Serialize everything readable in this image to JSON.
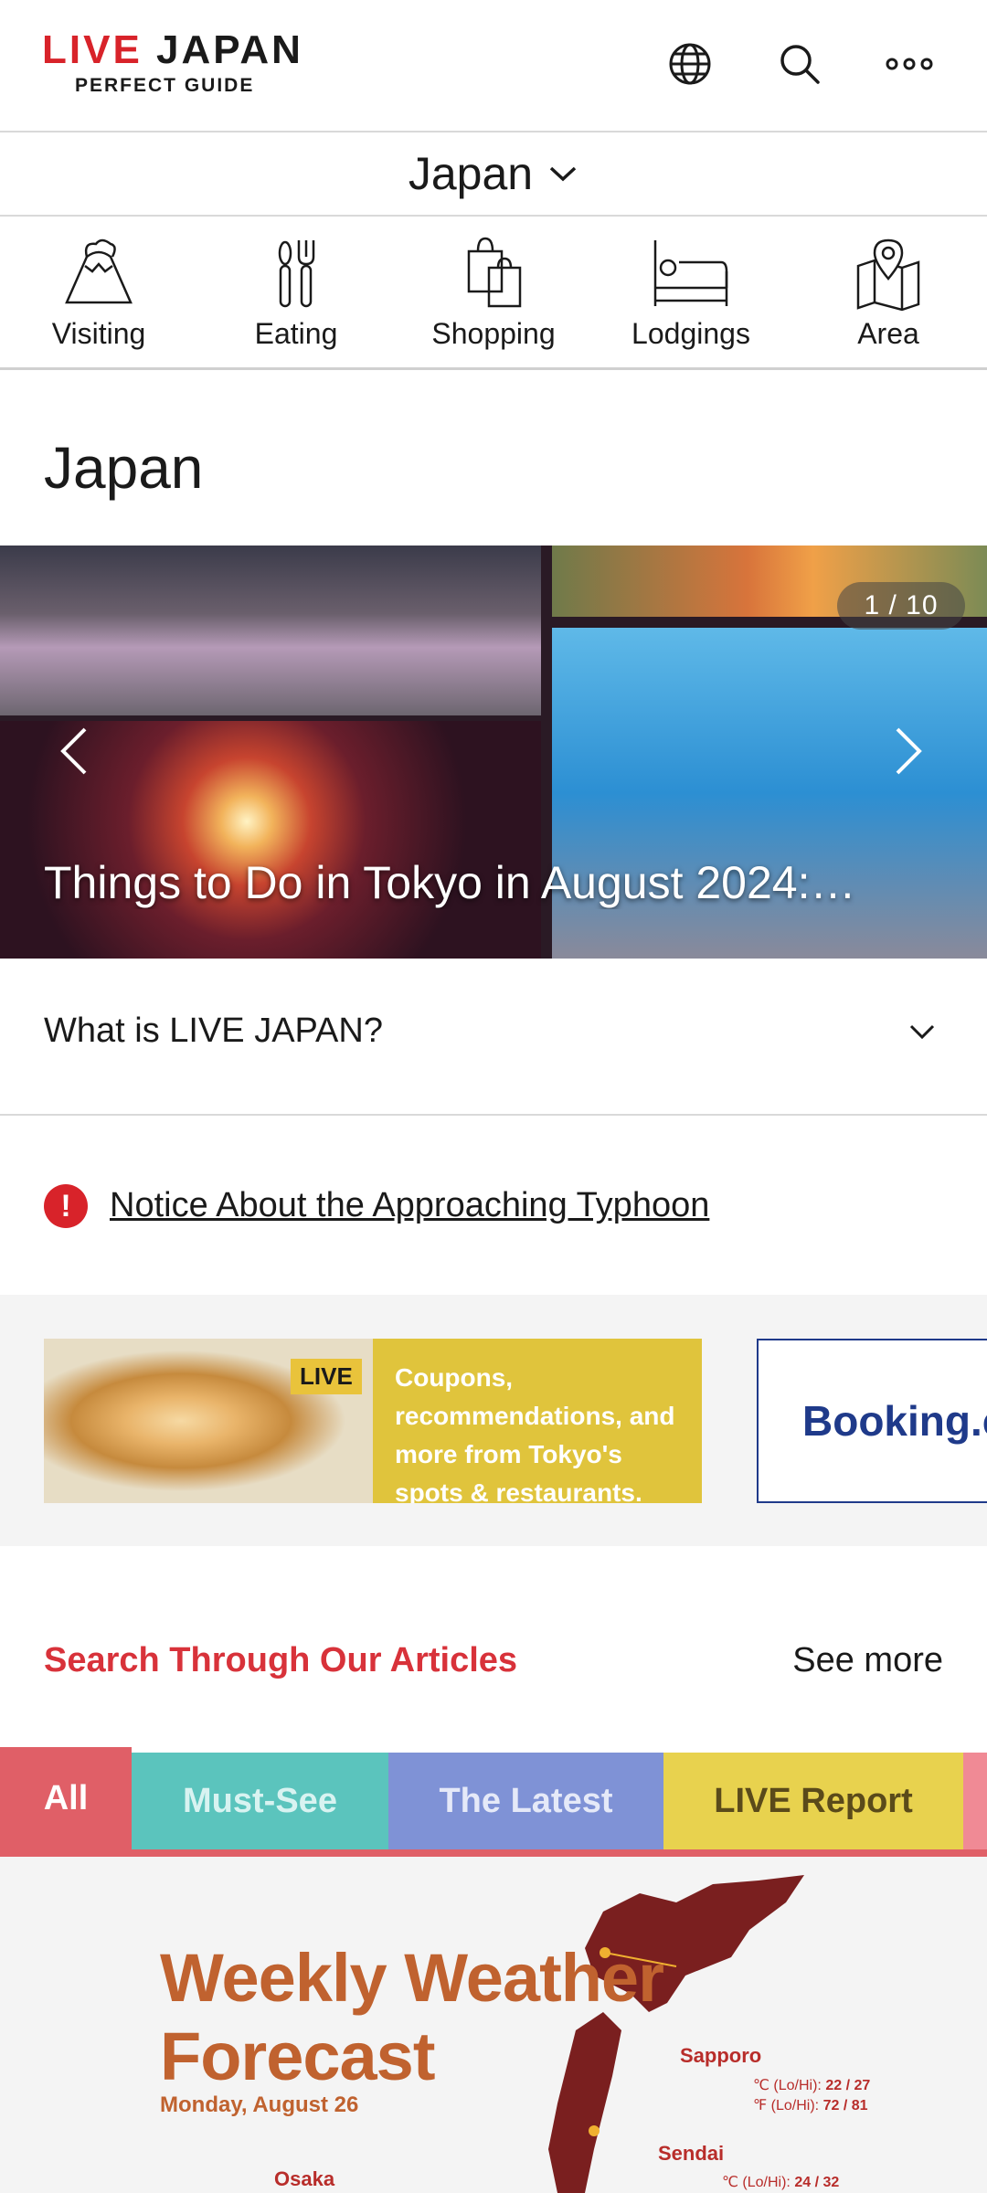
{
  "header": {
    "logo_main_live": "LIVE",
    "logo_main_japan": "JAPAN",
    "logo_sub": "PERFECT GUIDE",
    "icons": [
      "globe-icon",
      "search-icon",
      "more-icon"
    ]
  },
  "region": {
    "label": "Japan"
  },
  "categories": [
    {
      "label": "Visiting",
      "icon": "mount-fuji-icon"
    },
    {
      "label": "Eating",
      "icon": "cutlery-icon"
    },
    {
      "label": "Shopping",
      "icon": "shopping-bags-icon"
    },
    {
      "label": "Lodgings",
      "icon": "bed-icon"
    },
    {
      "label": "Area",
      "icon": "map-pin-icon"
    }
  ],
  "page_title": "Japan",
  "carousel": {
    "counter": "1 / 10",
    "caption": "Things to Do in Tokyo in August 2024:…"
  },
  "accordion": {
    "label": "What is LIVE JAPAN?"
  },
  "notice": {
    "label": "Notice About the Approaching Typhoon"
  },
  "banners": {
    "coupon_badge": "LIVE",
    "coupon_text": "Coupons, recommendations, and more from Tokyo's spots & restaurants.",
    "booking_text": "Booking.co"
  },
  "articles": {
    "title": "Search Through Our Articles",
    "see_more": "See more",
    "tabs": [
      {
        "label": "All",
        "color": "#e05f67",
        "text_color": "#ffffff"
      },
      {
        "label": "Must-See",
        "color": "#5bc4bd",
        "text_color": "#d8f3f1"
      },
      {
        "label": "The Latest",
        "color": "#7f92d6",
        "text_color": "#e5e9f8"
      },
      {
        "label": "LIVE Report",
        "color": "#e8d24e",
        "text_color": "#5a4a1a"
      }
    ]
  },
  "weather": {
    "title_line1": "Weekly Weather",
    "title_line2": "Forecast",
    "date": "Monday, August 26",
    "sapporo": {
      "city": "Sapporo",
      "c_label": "℃ (Lo/Hi):",
      "c_val": "22 / 27",
      "f_label": "℉ (Lo/Hi):",
      "f_val": "72 / 81"
    },
    "sendai": {
      "city": "Sendai",
      "c_label": "℃ (Lo/Hi):",
      "c_val": "24 / 32"
    },
    "osaka": {
      "city": "Osaka"
    }
  },
  "colors": {
    "brand_red": "#d8232a",
    "accent_red": "#d8323a",
    "weather_brown": "#c0622f"
  }
}
